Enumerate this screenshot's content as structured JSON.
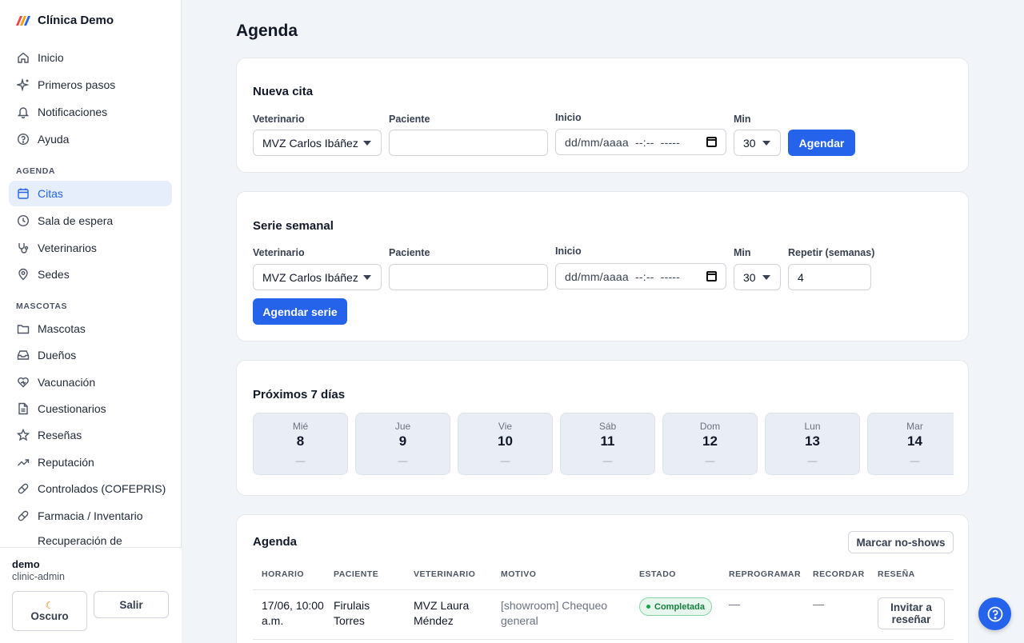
{
  "brand": {
    "name": "Clínica Demo"
  },
  "sidebar": {
    "top_items": [
      {
        "label": "Inicio",
        "icon": "home-icon"
      },
      {
        "label": "Primeros pasos",
        "icon": "sparkles-icon"
      },
      {
        "label": "Notificaciones",
        "icon": "bell-icon"
      },
      {
        "label": "Ayuda",
        "icon": "help-circle-icon"
      }
    ],
    "section_agenda": "AGENDA",
    "agenda_items": [
      {
        "label": "Citas",
        "icon": "calendar-icon",
        "active": true
      },
      {
        "label": "Sala de espera",
        "icon": "clock-icon"
      },
      {
        "label": "Veterinarios",
        "icon": "stethoscope-icon"
      },
      {
        "label": "Sedes",
        "icon": "map-pin-icon"
      }
    ],
    "section_mascotas": "MASCOTAS",
    "mascotas_items": [
      {
        "label": "Mascotas",
        "icon": "folder-icon"
      },
      {
        "label": "Dueños",
        "icon": "inbox-icon"
      },
      {
        "label": "Vacunación",
        "icon": "heart-icon"
      },
      {
        "label": "Cuestionarios",
        "icon": "file-icon"
      },
      {
        "label": "Reseñas",
        "icon": "star-icon"
      },
      {
        "label": "Reputación",
        "icon": "trending-up-icon"
      },
      {
        "label": "Controlados (COFEPRIS)",
        "icon": "pill-icon"
      },
      {
        "label": "Farmacia / Inventario",
        "icon": "pill-icon"
      },
      {
        "label": "Recuperación de",
        "icon": "list-icon"
      }
    ],
    "user": {
      "name": "demo",
      "role": "clinic-admin"
    },
    "dark_label": "Oscuro",
    "exit_label": "Salir"
  },
  "page": {
    "title": "Agenda"
  },
  "nueva_cita": {
    "title": "Nueva cita",
    "vet_label": "Veterinario",
    "vet_value": "MVZ Carlos Ibáñez",
    "patient_label": "Paciente",
    "patient_value": "",
    "start_label": "Inicio",
    "start_placeholder": "dd/mm/aaaa  --:--  -----",
    "min_label": "Min",
    "min_value": "30",
    "submit": "Agendar"
  },
  "serie": {
    "title": "Serie semanal",
    "vet_label": "Veterinario",
    "vet_value": "MVZ Carlos Ibáñez",
    "patient_label": "Paciente",
    "patient_value": "",
    "start_label": "Inicio",
    "start_placeholder": "dd/mm/aaaa  --:--  -----",
    "min_label": "Min",
    "min_value": "30",
    "repeat_label": "Repetir (semanas)",
    "repeat_value": "4",
    "submit": "Agendar serie"
  },
  "next7": {
    "title": "Próximos 7 días",
    "days": [
      {
        "name": "Mié",
        "num": "8",
        "count": "—"
      },
      {
        "name": "Jue",
        "num": "9",
        "count": "—"
      },
      {
        "name": "Vie",
        "num": "10",
        "count": "—"
      },
      {
        "name": "Sáb",
        "num": "11",
        "count": "—"
      },
      {
        "name": "Dom",
        "num": "12",
        "count": "—"
      },
      {
        "name": "Lun",
        "num": "13",
        "count": "—"
      },
      {
        "name": "Mar",
        "num": "14",
        "count": "—"
      }
    ]
  },
  "agenda": {
    "title": "Agenda",
    "noshow_button": "Marcar no-shows",
    "columns": [
      "HORARIO",
      "PACIENTE",
      "VETERINARIO",
      "MOTIVO",
      "ESTADO",
      "REPROGRAMAR",
      "RECORDAR",
      "RESEÑA"
    ],
    "rows": [
      {
        "horario": "17/06, 10:00 a.m.",
        "paciente": "Firulais Torres",
        "veterinario": "MVZ Laura Méndez",
        "motivo": "[showroom] Chequeo general",
        "estado": "Completada",
        "reprogramar": "—",
        "recordar": "—",
        "resena": "Invitar a reseñar"
      }
    ]
  },
  "colors": {
    "accent": "#2563eb",
    "active_bg": "#e6eefc",
    "status_green": "#15803d"
  }
}
